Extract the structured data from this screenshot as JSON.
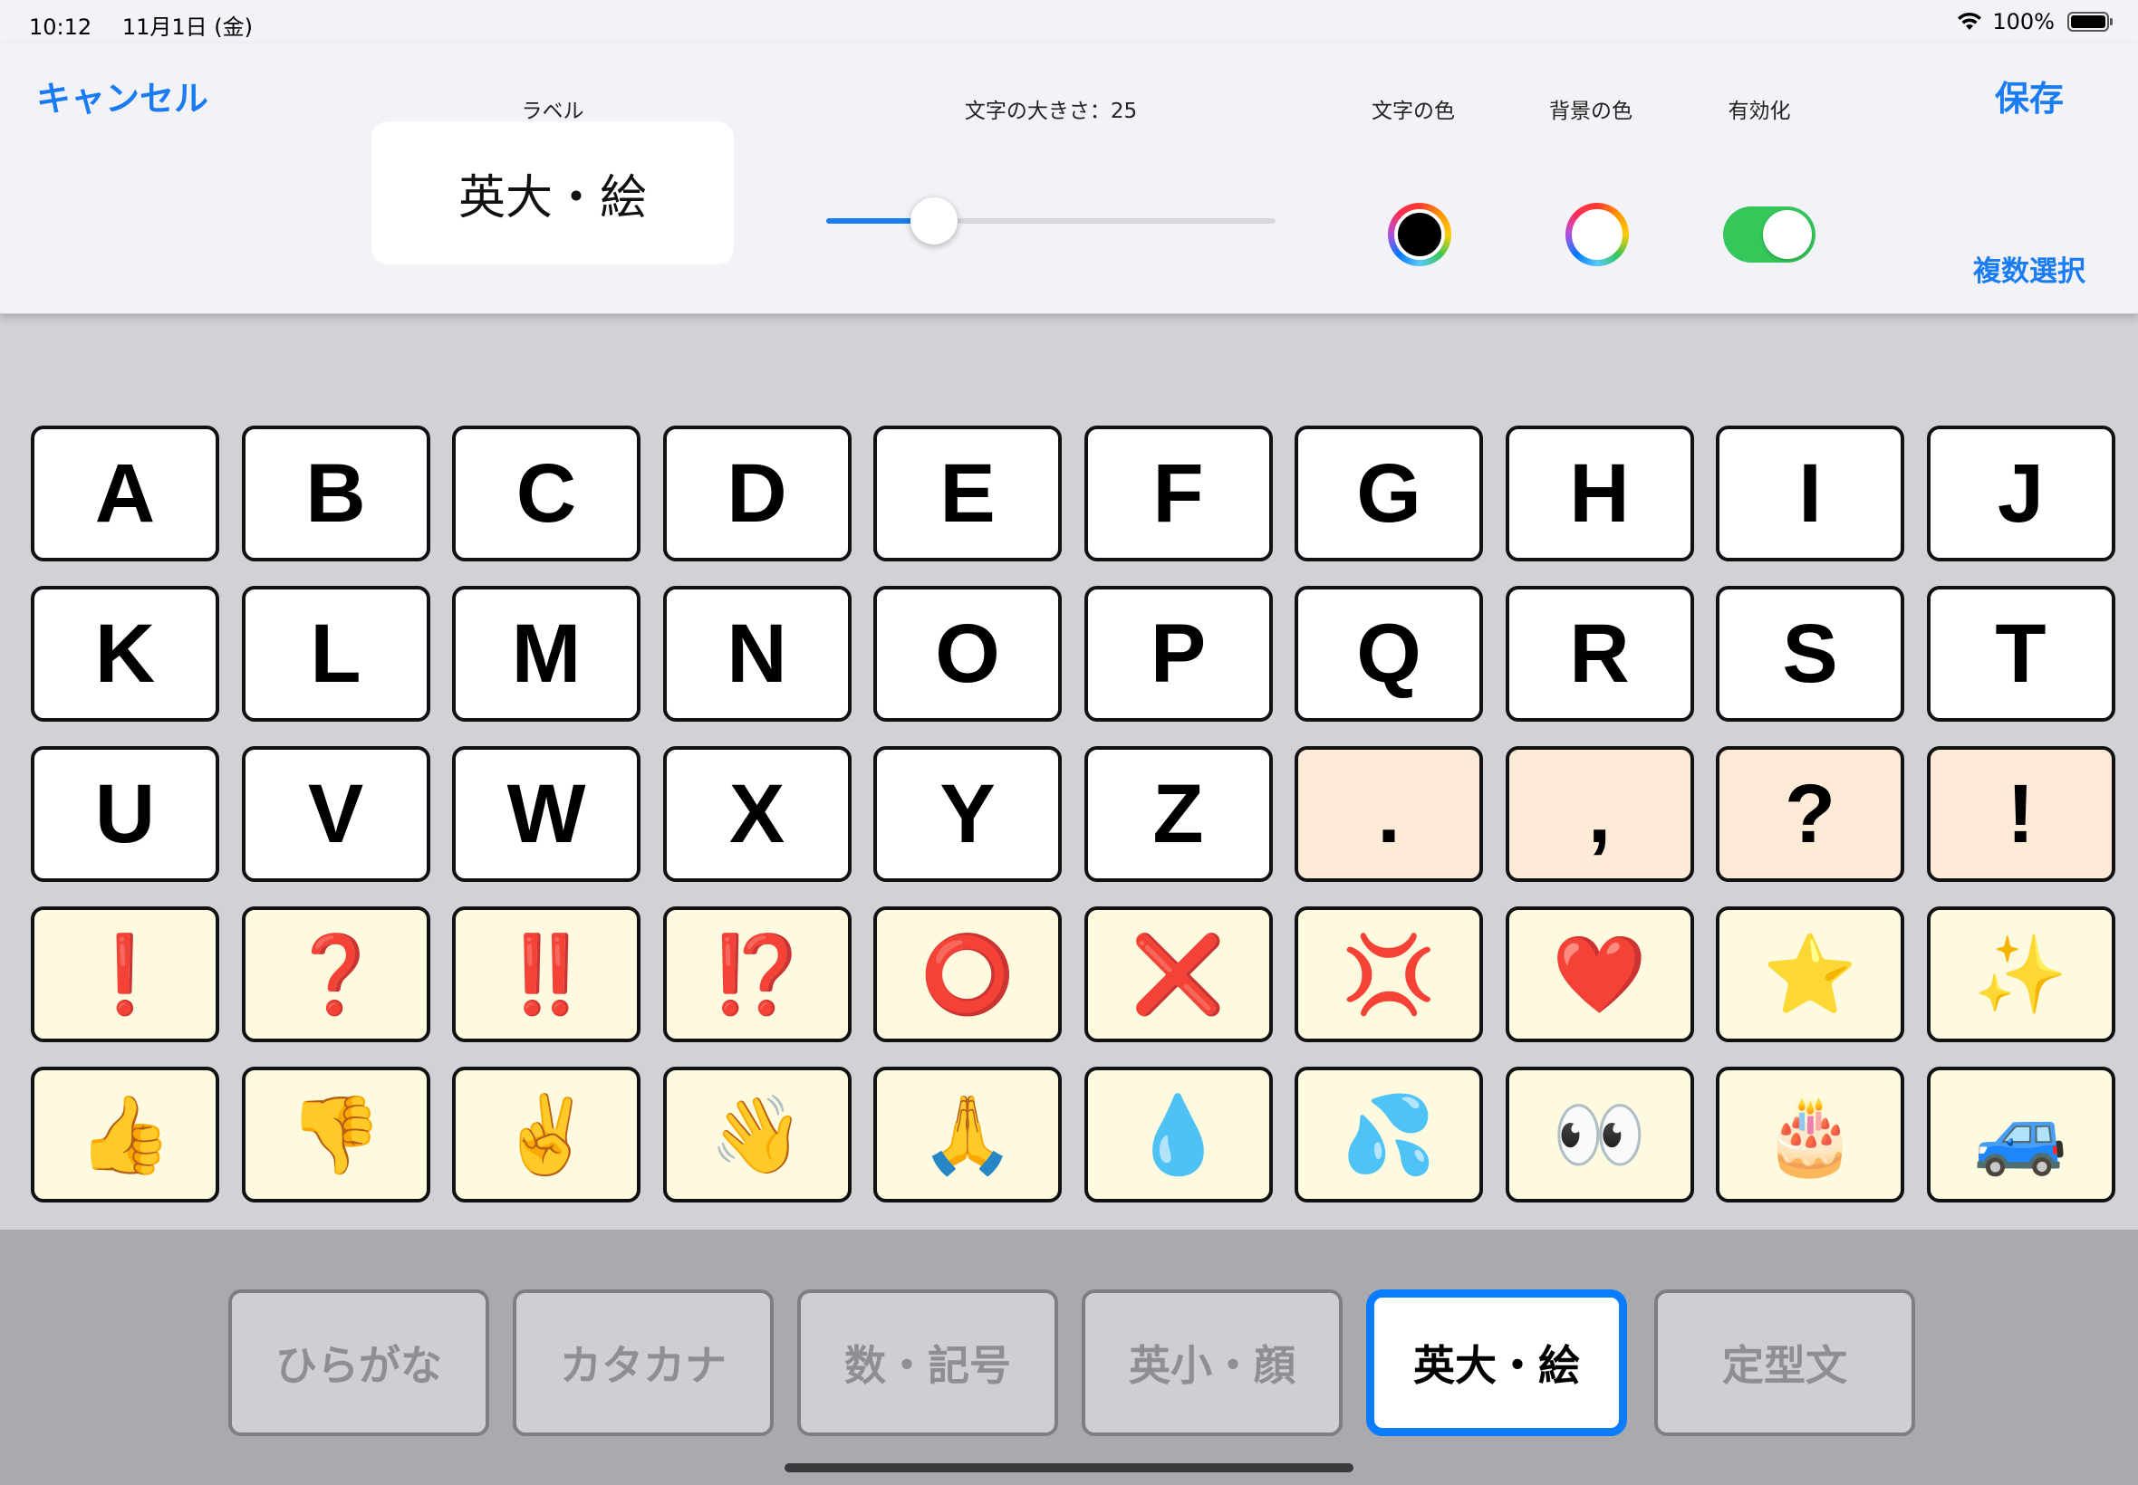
{
  "status_bar": {
    "time": "10:12",
    "date": "11月1日 (金)",
    "battery": "100%"
  },
  "header": {
    "cancel_label": "キャンセル",
    "save_label": "保存",
    "multi_select_label": "複数選択",
    "label_caption": "ラベル",
    "label_value": "英大・絵",
    "font_size_caption": "文字の大きさ：25",
    "font_size_value": 25,
    "font_size_slider_fraction": 0.24,
    "text_color_caption": "文字の色",
    "text_color": "#000000",
    "bg_color_caption": "背景の色",
    "bg_color": "#ffffff",
    "enable_caption": "有効化",
    "enabled": true,
    "accent_color": "#1a7cf2"
  },
  "keys": [
    {
      "label": "A",
      "bg": "white"
    },
    {
      "label": "B",
      "bg": "white"
    },
    {
      "label": "C",
      "bg": "white"
    },
    {
      "label": "D",
      "bg": "white"
    },
    {
      "label": "E",
      "bg": "white"
    },
    {
      "label": "F",
      "bg": "white"
    },
    {
      "label": "G",
      "bg": "white"
    },
    {
      "label": "H",
      "bg": "white"
    },
    {
      "label": "I",
      "bg": "white"
    },
    {
      "label": "J",
      "bg": "white"
    },
    {
      "label": "K",
      "bg": "white"
    },
    {
      "label": "L",
      "bg": "white"
    },
    {
      "label": "M",
      "bg": "white"
    },
    {
      "label": "N",
      "bg": "white"
    },
    {
      "label": "O",
      "bg": "white"
    },
    {
      "label": "P",
      "bg": "white"
    },
    {
      "label": "Q",
      "bg": "white"
    },
    {
      "label": "R",
      "bg": "white"
    },
    {
      "label": "S",
      "bg": "white"
    },
    {
      "label": "T",
      "bg": "white"
    },
    {
      "label": "U",
      "bg": "white"
    },
    {
      "label": "V",
      "bg": "white"
    },
    {
      "label": "W",
      "bg": "white"
    },
    {
      "label": "X",
      "bg": "white"
    },
    {
      "label": "Y",
      "bg": "white"
    },
    {
      "label": "Z",
      "bg": "white"
    },
    {
      "label": ".",
      "bg": "peach"
    },
    {
      "label": ",",
      "bg": "peach"
    },
    {
      "label": "?",
      "bg": "peach"
    },
    {
      "label": "!",
      "bg": "peach"
    },
    {
      "label": "❗",
      "bg": "cream",
      "emoji": true,
      "red": true
    },
    {
      "label": "❓",
      "bg": "cream",
      "emoji": true,
      "red": true
    },
    {
      "label": "‼️",
      "bg": "cream",
      "emoji": true,
      "red": true
    },
    {
      "label": "⁉️",
      "bg": "cream",
      "emoji": true,
      "red": true
    },
    {
      "label": "⭕",
      "bg": "cream",
      "emoji": true,
      "red": true
    },
    {
      "label": "❌",
      "bg": "cream",
      "emoji": true,
      "red": true
    },
    {
      "label": "💢",
      "bg": "cream",
      "emoji": true,
      "red": true
    },
    {
      "label": "❤️",
      "bg": "cream",
      "emoji": true,
      "red": true
    },
    {
      "label": "⭐",
      "bg": "cream",
      "emoji": true
    },
    {
      "label": "✨",
      "bg": "cream",
      "emoji": true
    },
    {
      "label": "👍",
      "bg": "cream",
      "emoji": true
    },
    {
      "label": "👎",
      "bg": "cream",
      "emoji": true
    },
    {
      "label": "✌️",
      "bg": "cream",
      "emoji": true
    },
    {
      "label": "👋",
      "bg": "cream",
      "emoji": true
    },
    {
      "label": "🙏",
      "bg": "cream",
      "emoji": true
    },
    {
      "label": "💧",
      "bg": "cream",
      "emoji": true
    },
    {
      "label": "💦",
      "bg": "cream",
      "emoji": true
    },
    {
      "label": "👀",
      "bg": "cream",
      "emoji": true
    },
    {
      "label": "🎂",
      "bg": "cream",
      "emoji": true
    },
    {
      "label": "🚙",
      "bg": "cream",
      "emoji": true
    }
  ],
  "tabs": [
    {
      "label": "ひらがな",
      "active": false
    },
    {
      "label": "カタカナ",
      "active": false
    },
    {
      "label": "数・記号",
      "active": false
    },
    {
      "label": "英小・顔",
      "active": false
    },
    {
      "label": "英大・絵",
      "active": true
    },
    {
      "label": "定型文",
      "active": false
    }
  ]
}
